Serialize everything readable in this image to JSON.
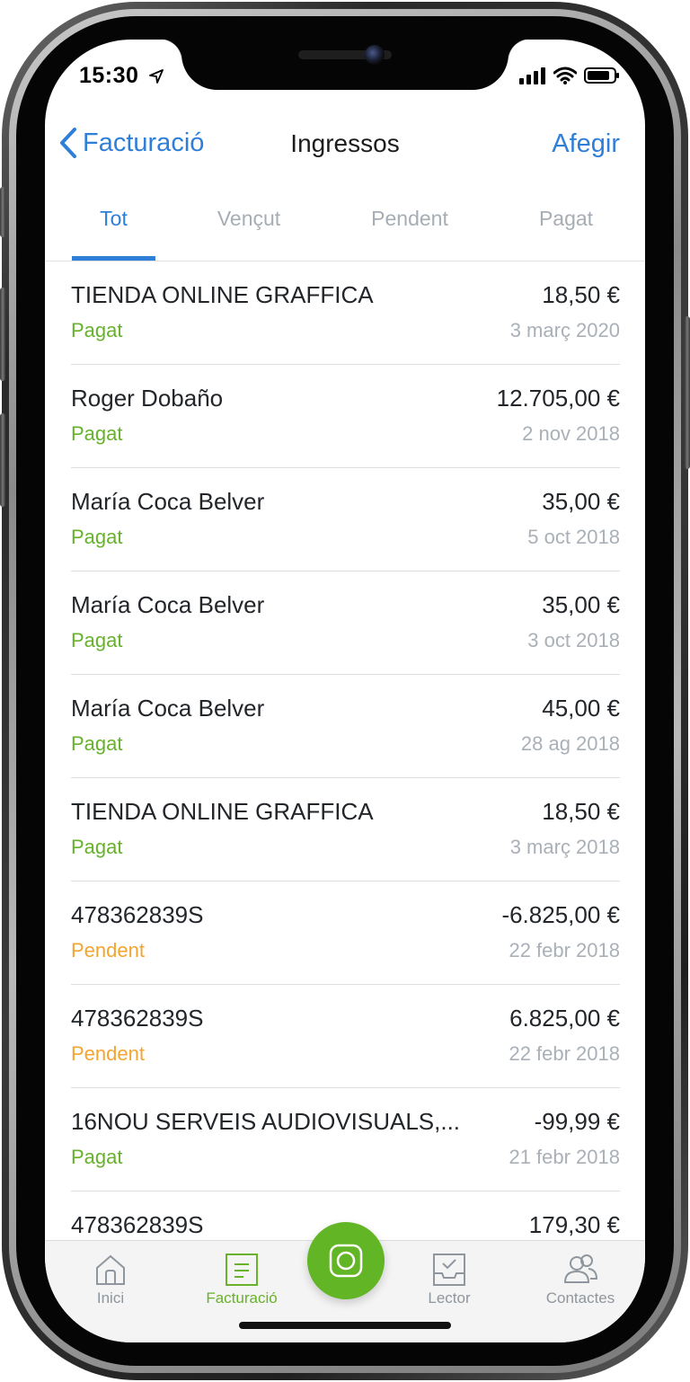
{
  "status_bar": {
    "time": "15:30"
  },
  "nav": {
    "back_label": "Facturació",
    "title": "Ingressos",
    "add_label": "Afegir"
  },
  "tabs": [
    {
      "label": "Tot",
      "active": true
    },
    {
      "label": "Vençut",
      "active": false
    },
    {
      "label": "Pendent",
      "active": false
    },
    {
      "label": "Pagat",
      "active": false
    }
  ],
  "invoices": [
    {
      "name": "TIENDA ONLINE GRAFFICA",
      "amount": "18,50 €",
      "status": "Pagat",
      "date": "3 març 2020"
    },
    {
      "name": "Roger Dobaño",
      "amount": "12.705,00 €",
      "status": "Pagat",
      "date": "2 nov 2018"
    },
    {
      "name": "María Coca Belver",
      "amount": "35,00 €",
      "status": "Pagat",
      "date": "5 oct 2018"
    },
    {
      "name": "María Coca Belver",
      "amount": "35,00 €",
      "status": "Pagat",
      "date": "3 oct 2018"
    },
    {
      "name": "María Coca Belver",
      "amount": "45,00 €",
      "status": "Pagat",
      "date": "28 ag 2018"
    },
    {
      "name": "TIENDA ONLINE GRAFFICA",
      "amount": "18,50 €",
      "status": "Pagat",
      "date": "3 març 2018"
    },
    {
      "name": "478362839S",
      "amount": "-6.825,00 €",
      "status": "Pendent",
      "date": "22 febr 2018"
    },
    {
      "name": "478362839S",
      "amount": "6.825,00 €",
      "status": "Pendent",
      "date": "22 febr 2018"
    },
    {
      "name": "16NOU SERVEIS AUDIOVISUALS,...",
      "amount": "-99,99 €",
      "status": "Pagat",
      "date": "21 febr 2018"
    },
    {
      "name": "478362839S",
      "amount": "179,30 €",
      "status": "",
      "date": ""
    }
  ],
  "status_colors": {
    "Pagat": "#66b22a",
    "Pendent": "#f2a531"
  },
  "tab_bar": {
    "items": [
      {
        "label": "Inici",
        "icon": "home-icon",
        "active": false
      },
      {
        "label": "Facturació",
        "icon": "invoice-icon",
        "active": true
      },
      {
        "label": "Lector",
        "icon": "inbox-check-icon",
        "active": false
      },
      {
        "label": "Contactes",
        "icon": "contacts-icon",
        "active": false
      }
    ],
    "fab_icon": "camera-icon"
  },
  "colors": {
    "accent": "#2f7fd8",
    "brand_green": "#62b525",
    "pending": "#f2a531"
  }
}
